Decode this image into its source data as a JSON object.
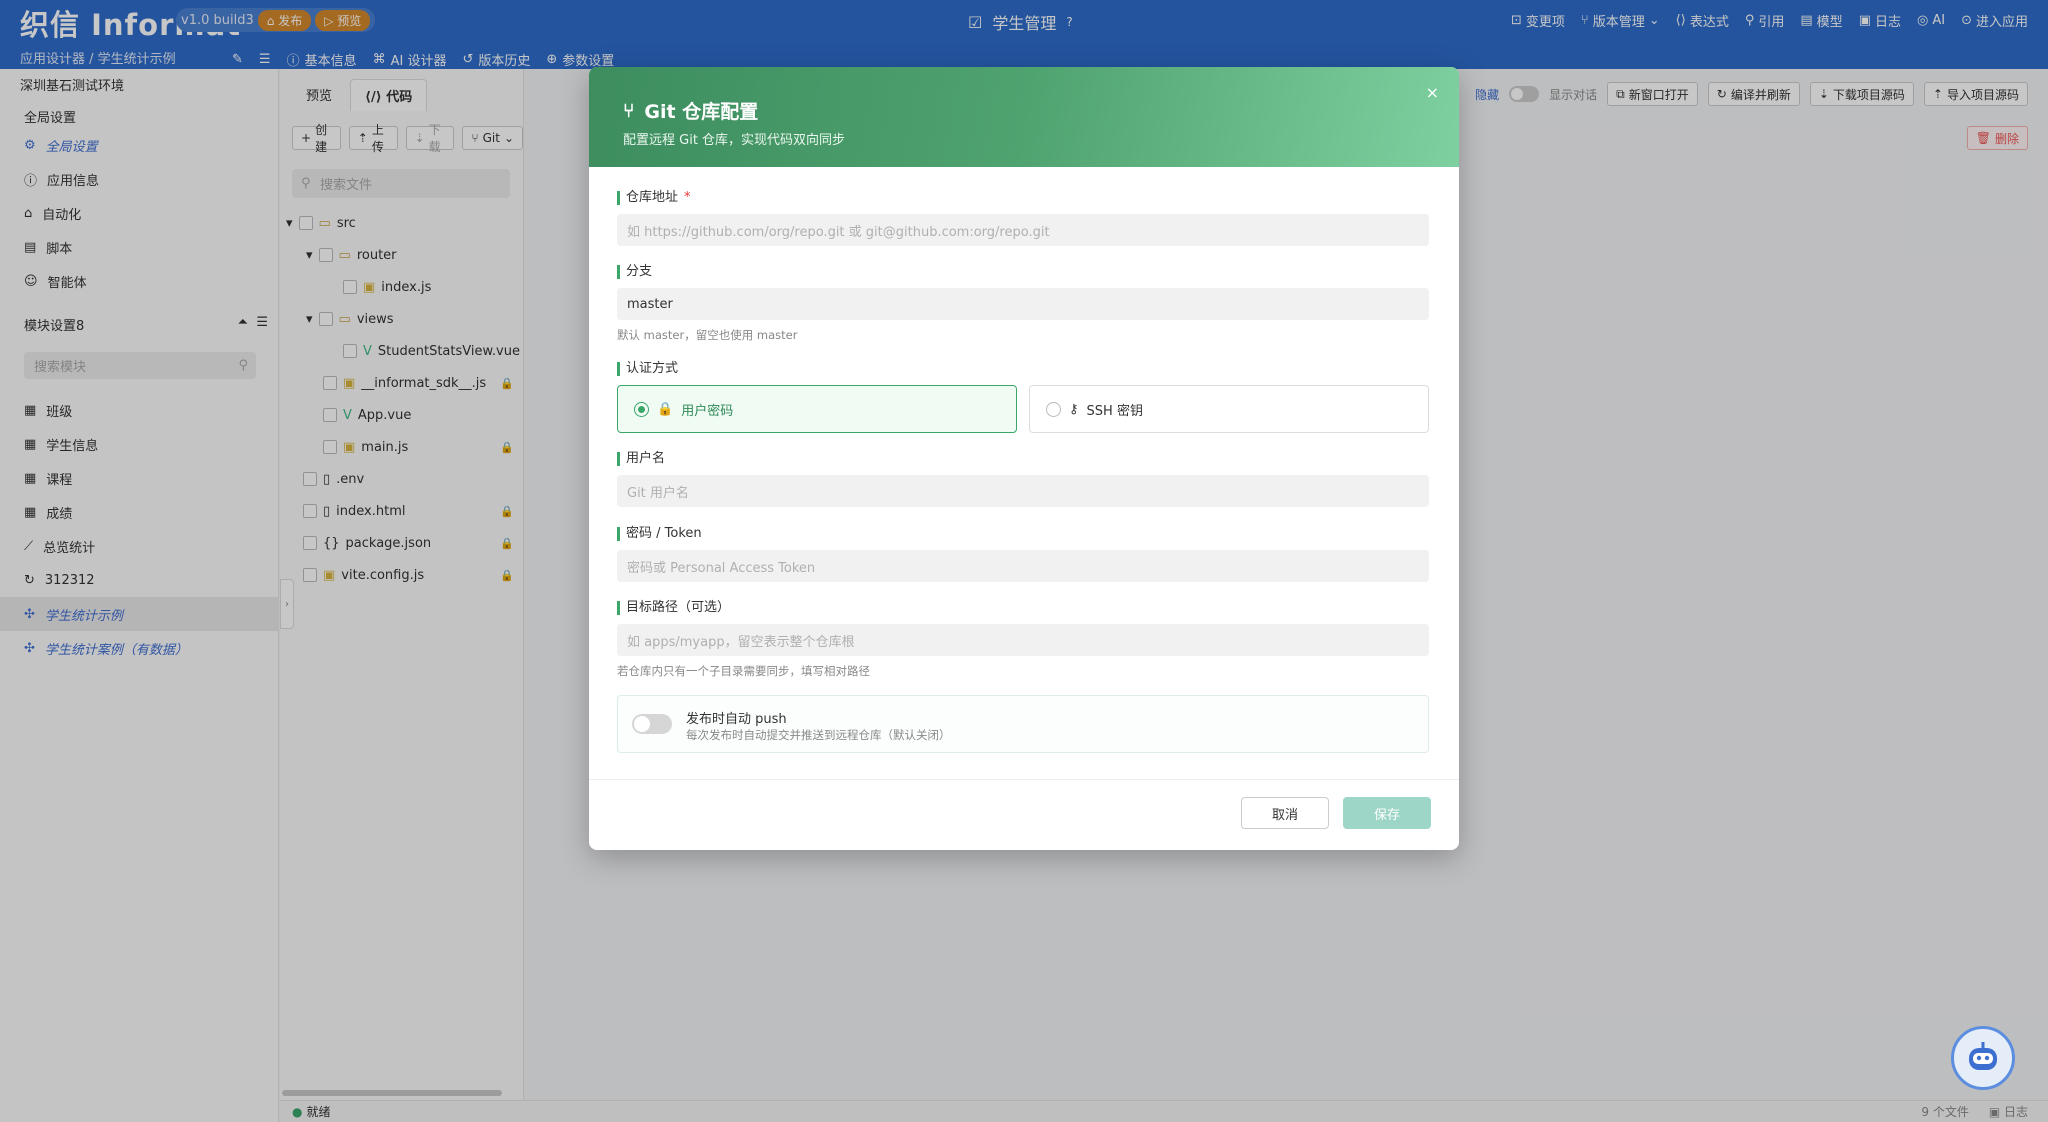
{
  "header": {
    "logo": "织信 Informat",
    "version": "v1.0 build3",
    "publish": "发布",
    "preview": "预览",
    "app_title": "学生管理",
    "menu": [
      "变更项",
      "版本管理",
      "表达式",
      "引用",
      "模型",
      "日志",
      "AI",
      "进入应用"
    ],
    "breadcrumb": "应用设计器 / 学生统计示例",
    "subnav": [
      "基本信息",
      "AI 设计器",
      "版本历史",
      "参数设置"
    ]
  },
  "sidebar": {
    "env": "深圳基石测试环境",
    "global_title": "全局设置",
    "global_items": [
      "全局设置",
      "应用信息",
      "自动化",
      "脚本",
      "智能体"
    ],
    "module_title": "模块设置8",
    "search_placeholder": "搜索模块",
    "modules": [
      "班级",
      "学生信息",
      "课程",
      "成绩",
      "总览统计",
      "312312",
      "学生统计示例",
      "学生统计案例（有数据）"
    ]
  },
  "files": {
    "tabs": [
      "预览",
      "代码"
    ],
    "toolbar": [
      "创建",
      "上传",
      "下载",
      "Git"
    ],
    "search_placeholder": "搜索文件",
    "tree": [
      "src",
      "router",
      "index.js",
      "views",
      "StudentStatsView.vue",
      "__informat_sdk__.js",
      "App.vue",
      "main.js",
      ".env",
      "index.html",
      "package.json",
      "vite.config.js"
    ]
  },
  "right_toolbar": {
    "hide": "隐藏",
    "show_dialog": "显示对话",
    "buttons": [
      "新窗口打开",
      "编译并刷新",
      "下载项目源码",
      "导入项目源码"
    ],
    "delete": "删除"
  },
  "status": {
    "left": "就绪",
    "files": "9 个文件",
    "log": "日志"
  },
  "modal": {
    "title": "Git 仓库配置",
    "subtitle": "配置远程 Git 仓库，实现代码双向同步",
    "close": "×",
    "repo_label": "仓库地址",
    "repo_required": "*",
    "repo_placeholder": "如 https://github.com/org/repo.git 或 git@github.com:org/repo.git",
    "branch_label": "分支",
    "branch_value": "master",
    "branch_hint": "默认 master，留空也使用 master",
    "auth_label": "认证方式",
    "auth_options": [
      "用户密码",
      "SSH 密钥"
    ],
    "user_label": "用户名",
    "user_placeholder": "Git 用户名",
    "pwd_label": "密码 / Token",
    "pwd_placeholder": "密码或 Personal Access Token",
    "path_label": "目标路径（可选）",
    "path_placeholder": "如 apps/myapp，留空表示整个仓库根",
    "path_hint": "若仓库内只有一个子目录需要同步，填写相对路径",
    "push_title": "发布时自动 push",
    "push_desc": "每次发布时自动提交并推送到远程仓库（默认关闭）",
    "cancel": "取消",
    "save": "保存"
  }
}
